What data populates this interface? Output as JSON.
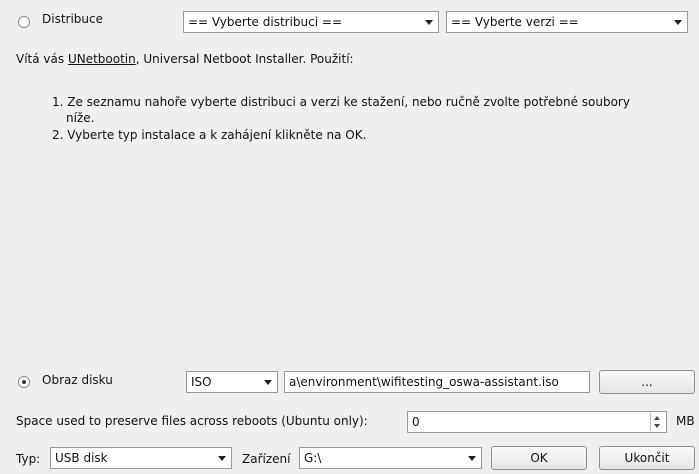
{
  "distribution": {
    "radio_label": "Distribuce",
    "distro_select": "== Vyberte distribuci ==",
    "version_select": "== Vyberte verzi =="
  },
  "intro": {
    "prefix": "Vítá vás ",
    "link": "UNetbootin",
    "suffix": ", Universal Netboot Installer. Použití:"
  },
  "instructions": [
    "1. Ze seznamu nahoře vyberte distribuci a verzi ke stažení, nebo ručně zvolte potřebné soubory",
    "níže.",
    "2. Vyberte typ instalace a k zahájení klikněte na OK."
  ],
  "disk_image": {
    "radio_label": "Obraz disku",
    "type_select": "ISO",
    "path_value": "a\\environment\\wifitesting_oswa-assistant.iso",
    "browse_label": "..."
  },
  "persistence": {
    "label": "Space used to preserve files across reboots (Ubuntu only):",
    "value": "0",
    "unit": "MB"
  },
  "footer": {
    "type_label": "Typ:",
    "type_value": "USB disk",
    "device_label": "Zařízení",
    "device_value": "G:\\",
    "ok_label": "OK",
    "cancel_label": "Ukončit"
  }
}
